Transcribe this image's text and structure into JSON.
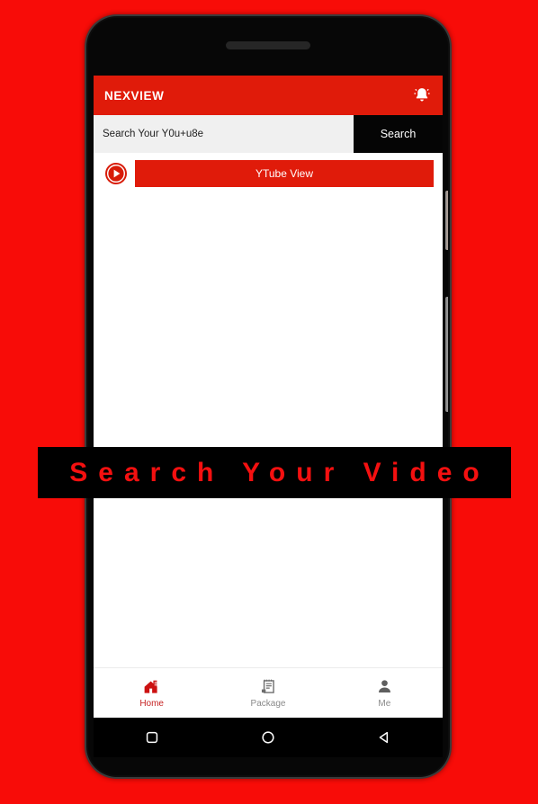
{
  "background_color": "#f80c08",
  "app": {
    "appbar": {
      "title": "NEXVIEW",
      "bell_icon": "bell-icon",
      "background": "#e01b0a",
      "title_color": "#ffffff"
    },
    "search": {
      "placeholder": "Search Your Y0u+u8e",
      "value": "",
      "button_label": "Search",
      "button_background": "#050505",
      "field_background": "#f0f0f0"
    },
    "ytube": {
      "play_icon": "play-circle-icon",
      "button_label": "YTube View",
      "button_background": "#e01b0a"
    },
    "tabbar": {
      "tabs": [
        {
          "label": "Home",
          "icon": "home-icon",
          "active": true,
          "color": "#c62222"
        },
        {
          "label": "Package",
          "icon": "package-icon",
          "active": false,
          "color": "#8a8a8a"
        },
        {
          "label": "Me",
          "icon": "person-icon",
          "active": false,
          "color": "#8a8a8a"
        }
      ]
    }
  },
  "system_nav": {
    "buttons": [
      {
        "name": "recents-button",
        "icon": "square-icon"
      },
      {
        "name": "home-button",
        "icon": "circle-icon"
      },
      {
        "name": "back-button",
        "icon": "triangle-left-icon"
      }
    ]
  },
  "banner": {
    "text": "Search Your Video",
    "text_color": "#f41010",
    "background": "#000000"
  },
  "device": {
    "speaker": "earpiece-speaker",
    "side_buttons": [
      "power-button",
      "volume-rocker"
    ]
  }
}
